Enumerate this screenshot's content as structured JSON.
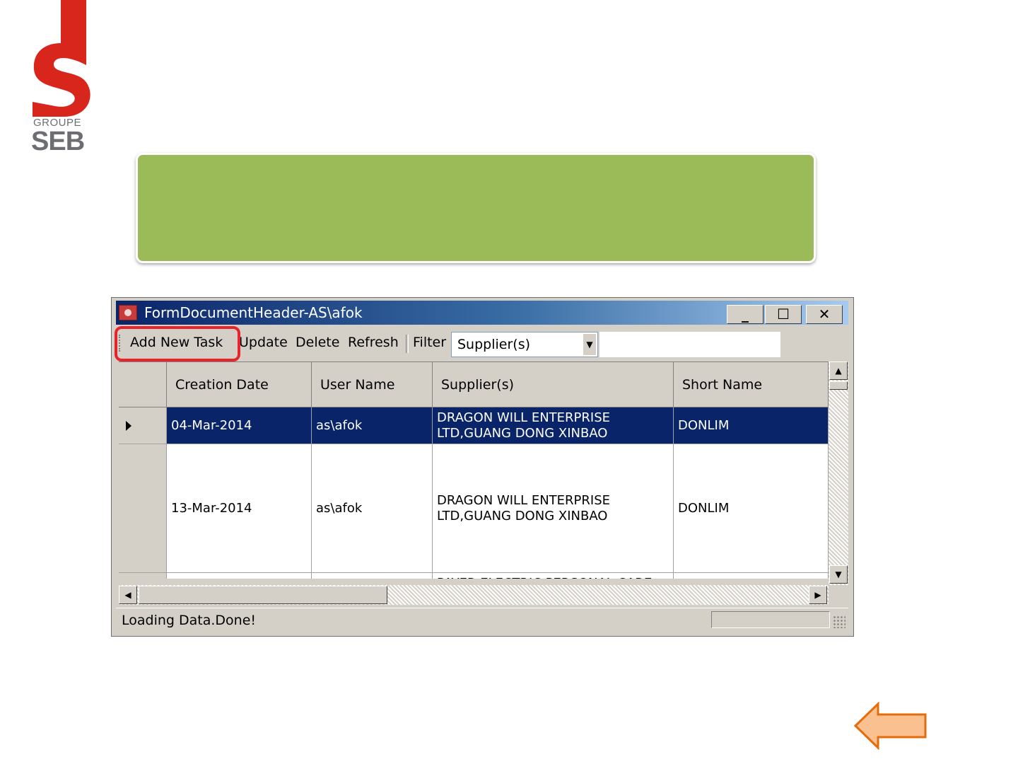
{
  "logo": {
    "line1": "GROUPE",
    "line2": "SEB",
    "brand_red": "#d9261c",
    "brand_grey": "#6d6e71"
  },
  "banner": {
    "color": "#9bbb59"
  },
  "window": {
    "title": "FormDocumentHeader-AS\\afok",
    "app_icon": "app-icon",
    "controls": {
      "minimize": "_",
      "maximize": "☐",
      "close": "✕"
    },
    "toolbar": {
      "add_new_task": "Add New Task",
      "update": "Update",
      "delete": "Delete",
      "refresh": "Refresh",
      "filter_label": "Filter",
      "filter_select_value": "Supplier(s)",
      "filter_input_value": ""
    },
    "highlight_color": "#e8232a",
    "grid": {
      "columns": [
        "Creation Date",
        "User Name",
        "Supplier(s)",
        "Short Name"
      ],
      "rows": [
        {
          "creation_date": "04-Mar-2014",
          "user_name": "as\\afok",
          "supplier": "DRAGON WILL ENTERPRISE LTD,GUANG DONG XINBAO",
          "short_name": "DONLIM",
          "selected": true
        },
        {
          "creation_date": "13-Mar-2014",
          "user_name": "as\\afok",
          "supplier": "DRAGON WILL ENTERPRISE LTD,GUANG DONG XINBAO",
          "short_name": "DONLIM",
          "selected": false
        },
        {
          "creation_date": "",
          "user_name": "",
          "supplier": "PAYER ELECTRIC PERSONAL CARE",
          "short_name": "",
          "selected": false
        }
      ],
      "selection_color": "#0a246a"
    },
    "status": {
      "text": "Loading Data.Done!"
    }
  },
  "navigation": {
    "back_icon": "back-arrow-icon",
    "arrow_fill": "#fac090",
    "arrow_stroke": "#e46c0a"
  }
}
